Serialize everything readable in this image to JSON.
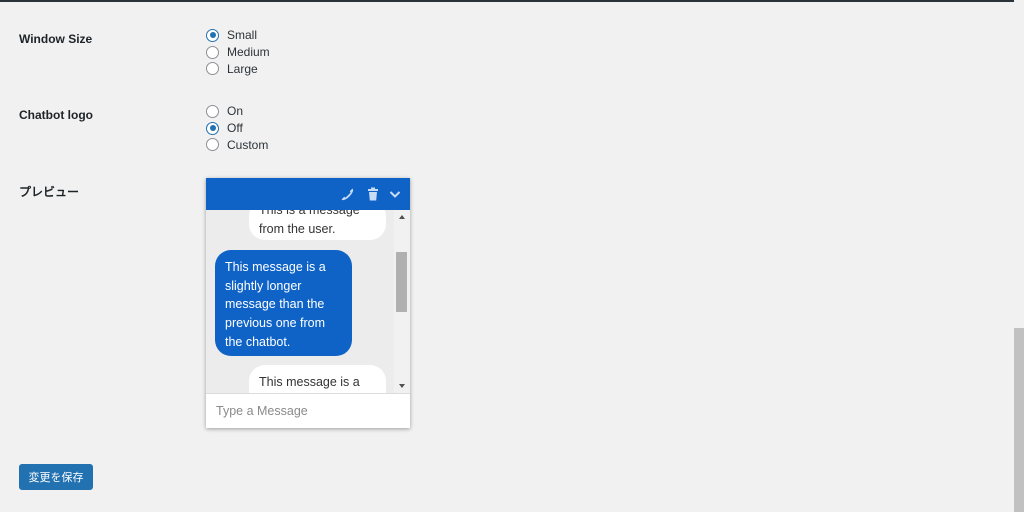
{
  "settings": {
    "window_size": {
      "label": "Window Size",
      "options": [
        "Small",
        "Medium",
        "Large"
      ],
      "selected": "Small"
    },
    "chatbot_logo": {
      "label": "Chatbot logo",
      "options": [
        "On",
        "Off",
        "Custom"
      ],
      "selected": "Off"
    },
    "preview_label": "プレビュー"
  },
  "chat": {
    "header_icons": [
      "phone-icon",
      "trash-icon",
      "chevron-down-icon"
    ],
    "accent_color": "#0f63c7",
    "messages": [
      {
        "from": "user",
        "lines": [
          "This is a message",
          "from the user."
        ]
      },
      {
        "from": "bot",
        "lines": [
          "This message is a",
          "slightly longer",
          "message than the",
          "previous one from",
          "the chatbot."
        ]
      },
      {
        "from": "user",
        "lines": [
          "This message is a"
        ]
      }
    ],
    "input_placeholder": "Type a Message"
  },
  "footer": {
    "save_label": "変更を保存"
  },
  "colors": {
    "background": "#f1f1f1",
    "primary_button": "#2271b1",
    "radio_checked": "#2271b1"
  }
}
